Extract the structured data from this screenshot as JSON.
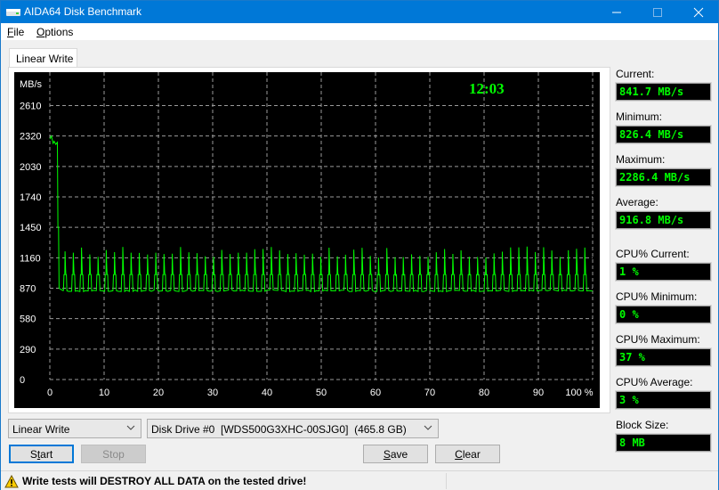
{
  "window": {
    "title": "AIDA64 Disk Benchmark",
    "icons": {
      "app": "disk-drive-icon",
      "minimize": "minimize-icon",
      "maximize": "maximize-icon",
      "close": "close-icon"
    }
  },
  "menu": [
    {
      "label": "File",
      "accel": "F",
      "rest": "ile"
    },
    {
      "label": "Options",
      "accel": "O",
      "rest": "ptions"
    }
  ],
  "tabs": [
    {
      "label": "Linear Write",
      "active": true
    }
  ],
  "chart_data": {
    "type": "line",
    "title": "",
    "timer": "12:03",
    "xlabel": "%",
    "ylabel": "MB/s",
    "xlim": [
      0,
      100
    ],
    "ylim": [
      0,
      2610
    ],
    "grid": true,
    "y_ticks": [
      0,
      290,
      580,
      870,
      1160,
      1450,
      1740,
      2030,
      2320,
      2610
    ],
    "x_ticks": [
      "0",
      "10",
      "20",
      "30",
      "40",
      "50",
      "60",
      "70",
      "80",
      "90",
      "100 %"
    ],
    "line_color": "#00ff00",
    "series": [
      {
        "name": "Linear Write",
        "baseline": 845,
        "initial_points": [
          [
            0,
            2290
          ],
          [
            0.3,
            2320
          ],
          [
            0.6,
            2250
          ],
          [
            0.8,
            2270
          ],
          [
            1.1,
            2240
          ],
          [
            1.4,
            2260
          ],
          [
            1.5,
            1450
          ],
          [
            1.6,
            1450
          ],
          [
            1.7,
            870
          ],
          [
            2.0,
            860
          ],
          [
            2.5,
            845
          ]
        ],
        "spike_interval_pct": 1.52,
        "spike_start_pct": 2.9,
        "spike_end_pct": 99.6,
        "spike_peak_range": [
          1160,
          1270
        ],
        "spike_shoulder": 1000,
        "end_value": 842
      }
    ]
  },
  "stats": {
    "current": {
      "label": "Current:",
      "value": "841.7 MB/s"
    },
    "minimum": {
      "label": "Minimum:",
      "value": "826.4 MB/s"
    },
    "maximum": {
      "label": "Maximum:",
      "value": "2286.4 MB/s"
    },
    "average": {
      "label": "Average:",
      "value": "916.8 MB/s"
    },
    "cpu_current": {
      "label": "CPU% Current:",
      "value": "1 %"
    },
    "cpu_minimum": {
      "label": "CPU% Minimum:",
      "value": "0 %"
    },
    "cpu_maximum": {
      "label": "CPU% Maximum:",
      "value": "37 %"
    },
    "cpu_average": {
      "label": "CPU% Average:",
      "value": "3 %"
    },
    "block_size": {
      "label": "Block Size:",
      "value": "8 MB"
    }
  },
  "controls": {
    "test_select": "Linear Write",
    "drive_select": "Disk Drive #0  [WDS500G3XHC-00SJG0]  (465.8 GB)",
    "start": {
      "accel": "S",
      "pre": "S",
      "mid": "t",
      "post": "art"
    },
    "stop": "Stop",
    "save": {
      "accel": "S",
      "rest": "ave"
    },
    "clear": {
      "accel": "C",
      "rest": "lear"
    }
  },
  "status": {
    "icon": "warning-icon",
    "message": "Write tests will DESTROY ALL DATA on the tested drive!"
  }
}
